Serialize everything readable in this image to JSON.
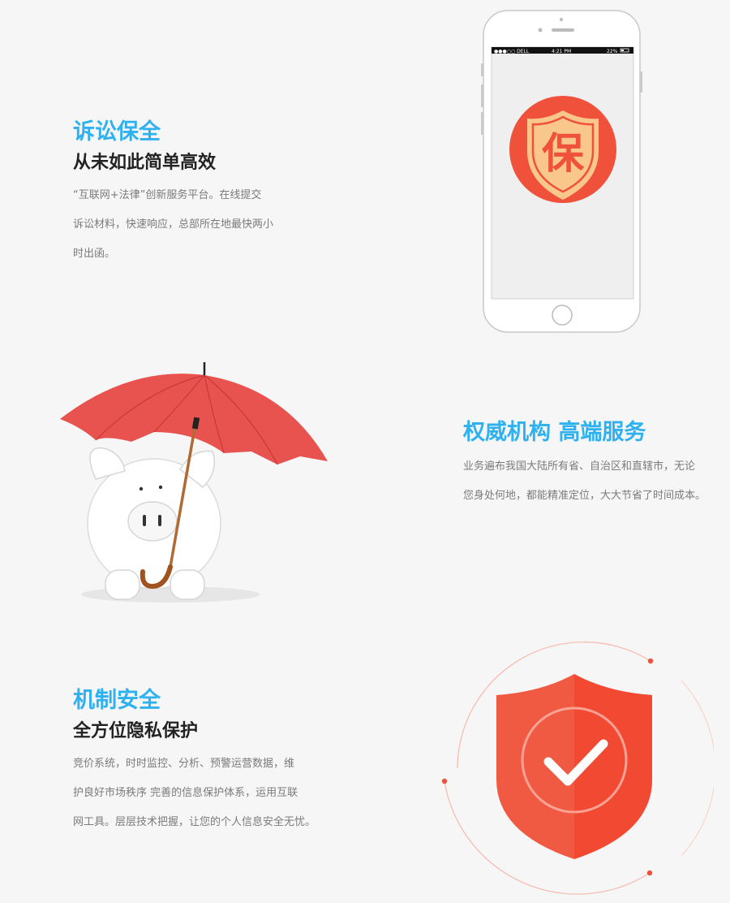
{
  "sections": [
    {
      "title": "诉讼保全",
      "subtitle": "从未如此简单高效",
      "lines": [
        "“互联网+法律”创新服务平台。在线提交",
        "诉讼材料，快速响应，总部所在地最快两小",
        "时出函。"
      ]
    },
    {
      "title": "权威机构 高端服务",
      "lines": [
        "业务遍布我国大陆所有省、自治区和直辖市，无论",
        "您身处何地，都能精准定位，大大节省了时间成本。"
      ]
    },
    {
      "title": "机制安全",
      "subtitle": "全方位隐私保护",
      "lines": [
        "竞价系统，时时监控、分析、预警运营数据，维",
        "护良好市场秩序 完善的信息保护体系，运用互联",
        "网工具。层层技术把握，让您的个人信息安全无忧。"
      ]
    }
  ],
  "phone": {
    "carrier": "●●●○○ DELL",
    "time": "4:21 PM",
    "battery": "22%",
    "badge_char": "保"
  },
  "colors": {
    "accent": "#2fb1f0",
    "red": "#f0513a",
    "badge_gold": "#f9c78a"
  },
  "icons": [
    "phone-illustration",
    "piggy-bank-umbrella-illustration",
    "shield-check-icon"
  ]
}
